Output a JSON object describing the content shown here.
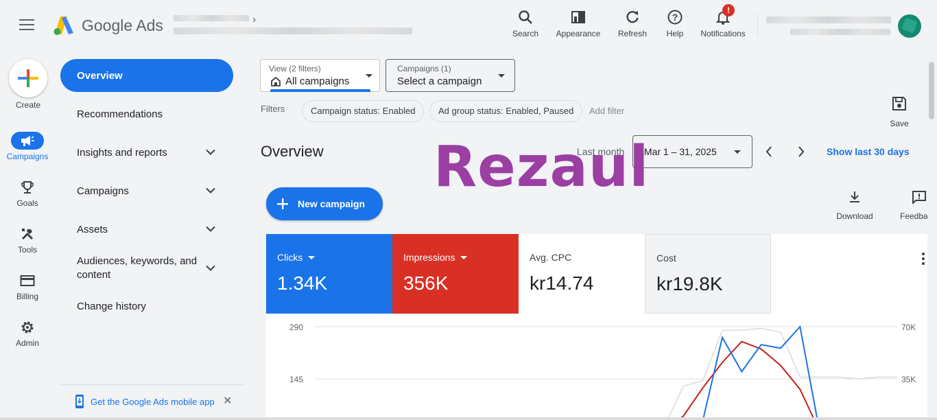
{
  "header": {
    "brand": "Google Ads",
    "tools": [
      {
        "label": "Search",
        "icon": "search-icon"
      },
      {
        "label": "Appearance",
        "icon": "appearance-icon"
      },
      {
        "label": "Refresh",
        "icon": "refresh-icon"
      },
      {
        "label": "Help",
        "icon": "help-icon"
      },
      {
        "label": "Notifications",
        "icon": "bell-icon",
        "badge": "!"
      }
    ]
  },
  "rail": {
    "create_label": "Create",
    "items": [
      {
        "label": "Campaigns",
        "icon": "megaphone-icon",
        "active": true
      },
      {
        "label": "Goals",
        "icon": "trophy-icon"
      },
      {
        "label": "Tools",
        "icon": "tools-icon"
      },
      {
        "label": "Billing",
        "icon": "credit-card-icon"
      },
      {
        "label": "Admin",
        "icon": "gear-icon"
      }
    ]
  },
  "nav": {
    "items": [
      {
        "label": "Overview",
        "active": true
      },
      {
        "label": "Recommendations"
      },
      {
        "label": "Insights and reports",
        "expandable": true
      },
      {
        "label": "Campaigns",
        "expandable": true
      },
      {
        "label": "Assets",
        "expandable": true
      },
      {
        "label": "Audiences, keywords, and content",
        "expandable": true
      },
      {
        "label": "Change history"
      }
    ],
    "mobile_app": "Get the Google Ads mobile app"
  },
  "filters": {
    "view_small": "View (2 filters)",
    "view_value": "All campaigns",
    "campaigns_small": "Campaigns (1)",
    "campaigns_value": "Select a campaign",
    "label": "Filters",
    "chips": [
      "Campaign status: Enabled",
      "Ad group status: Enabled, Paused"
    ],
    "add_filter": "Add filter",
    "save_label": "Save"
  },
  "overview": {
    "title": "Overview",
    "range_label": "Last month",
    "date_range": "Mar 1 – 31, 2025",
    "show_last": "Show last 30 days",
    "watermark": "Rezaul",
    "new_campaign": "New campaign",
    "download": "Download",
    "feedback": "Feedback"
  },
  "metrics": [
    {
      "name": "Clicks",
      "value": "1.34K",
      "color": "#1a73e8",
      "dropdown": true
    },
    {
      "name": "Impressions",
      "value": "356K",
      "color": "#d93025",
      "dropdown": true
    },
    {
      "name": "Avg. CPC",
      "value": "kr14.74",
      "color": "#ffffff"
    },
    {
      "name": "Cost",
      "value": "kr19.8K",
      "color": "#f1f3f4"
    }
  ],
  "chart_data": {
    "type": "line",
    "y_left_ticks": [
      "290",
      "145"
    ],
    "y_right_ticks": [
      "70K",
      "35K"
    ],
    "ylim_left": [
      0,
      290
    ],
    "ylim_right": [
      0,
      70000
    ],
    "series": [
      {
        "name": "Clicks",
        "color": "#1a73e8",
        "axis": "left",
        "values": [
          null,
          null,
          null,
          null,
          null,
          null,
          null,
          null,
          null,
          null,
          null,
          null,
          null,
          null,
          null,
          null,
          null,
          null,
          0,
          10,
          30,
          260,
          165,
          240,
          230,
          290,
          0,
          0,
          0,
          0,
          0
        ]
      },
      {
        "name": "Impressions",
        "color": "#c5221f",
        "axis": "right",
        "values": [
          null,
          null,
          null,
          null,
          null,
          null,
          null,
          null,
          null,
          null,
          null,
          null,
          null,
          null,
          null,
          null,
          null,
          null,
          0,
          10000,
          29000,
          46000,
          60000,
          55000,
          44000,
          28000,
          0,
          0,
          0,
          0,
          0
        ]
      },
      {
        "name": "Cost",
        "color": "#dadce0",
        "axis": "left",
        "values": [
          null,
          null,
          null,
          null,
          null,
          null,
          null,
          null,
          null,
          null,
          null,
          null,
          null,
          null,
          null,
          null,
          null,
          null,
          10,
          125,
          140,
          280,
          280,
          285,
          275,
          150,
          150,
          150,
          145,
          150,
          150
        ]
      }
    ]
  }
}
